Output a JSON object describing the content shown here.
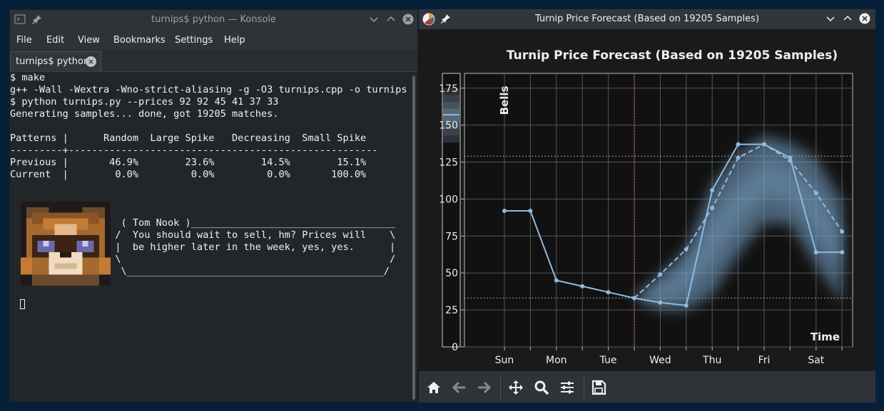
{
  "konsole": {
    "title": "turnips$ python — Konsole",
    "menu": [
      "File",
      "Edit",
      "View",
      "Bookmarks",
      "Settings",
      "Help"
    ],
    "tab": {
      "label": "turnips$ python",
      "close": "×"
    },
    "lines": [
      "$ make",
      "g++ -Wall -Wextra -Wno-strict-aliasing -g -O3 turnips.cpp -o turnips",
      "$ python turnips.py --prices 92 92 45 41 37 33",
      "Generating samples... done, got 19205 matches.",
      "",
      "Patterns |      Random  Large Spike   Decreasing  Small Spike",
      "---------+-----------------------------------------------------",
      "Previous |       46.9%        23.6%        14.5%        15.1%",
      "Current  |        0.0%         0.0%         0.0%       100.0%",
      "",
      "",
      "",
      "                   ( Tom Nook )___________________________________",
      "                  /  You should wait to sell, hm? Prices will    \\",
      "                  |  be higher later in the week, yes, yes.      |",
      "                  \\                                              /",
      "                   \\____________________________________________/"
    ]
  },
  "plot_window": {
    "title": "Turnip Price Forecast (Based on 19205 Samples)",
    "toolbar": [
      "home-icon",
      "back-arrow-icon",
      "forward-arrow-icon",
      "pan-icon",
      "zoom-icon",
      "configure-icon",
      "save-icon"
    ]
  },
  "colors": {
    "line": "#8fbadf",
    "band": "#7aa5cc",
    "vline": "#e05050",
    "plot_bg": "#111111",
    "grid": "#555555"
  },
  "chart_data": {
    "type": "line",
    "title": "Turnip Price Forecast (Based on 19205 Samples)",
    "xlabel": "Time",
    "ylabel": "Bells",
    "categories": [
      "Sun",
      "Mon",
      "Tue",
      "Wed",
      "Thu",
      "Fri",
      "Sat"
    ],
    "ylim": [
      0,
      185
    ],
    "yticks": [
      0,
      25,
      50,
      75,
      100,
      125,
      150,
      175
    ],
    "grid": true,
    "current_index": 5,
    "hlines": [
      129,
      33
    ],
    "series": [
      {
        "style": "solid",
        "x": [
          0,
          1,
          2,
          3,
          4,
          5,
          6,
          7,
          8,
          9,
          10,
          11,
          12,
          13
        ],
        "values": [
          92,
          92,
          45,
          41,
          37,
          33,
          30,
          28,
          106,
          137,
          137,
          128,
          64,
          64
        ]
      },
      {
        "style": "dashed",
        "x": [
          5,
          6,
          7,
          8,
          9,
          10,
          11,
          12,
          13
        ],
        "values": [
          33,
          49,
          66,
          94,
          128,
          137,
          126,
          104,
          78
        ]
      }
    ],
    "band": {
      "x": [
        5,
        6,
        7,
        8,
        9,
        10,
        11,
        12,
        13
      ],
      "upper": [
        33,
        49,
        66,
        110,
        131,
        143,
        138,
        128,
        99
      ],
      "lower": [
        33,
        25,
        25,
        35,
        62,
        84,
        83,
        55,
        30
      ]
    },
    "colorbar_value": 157
  }
}
